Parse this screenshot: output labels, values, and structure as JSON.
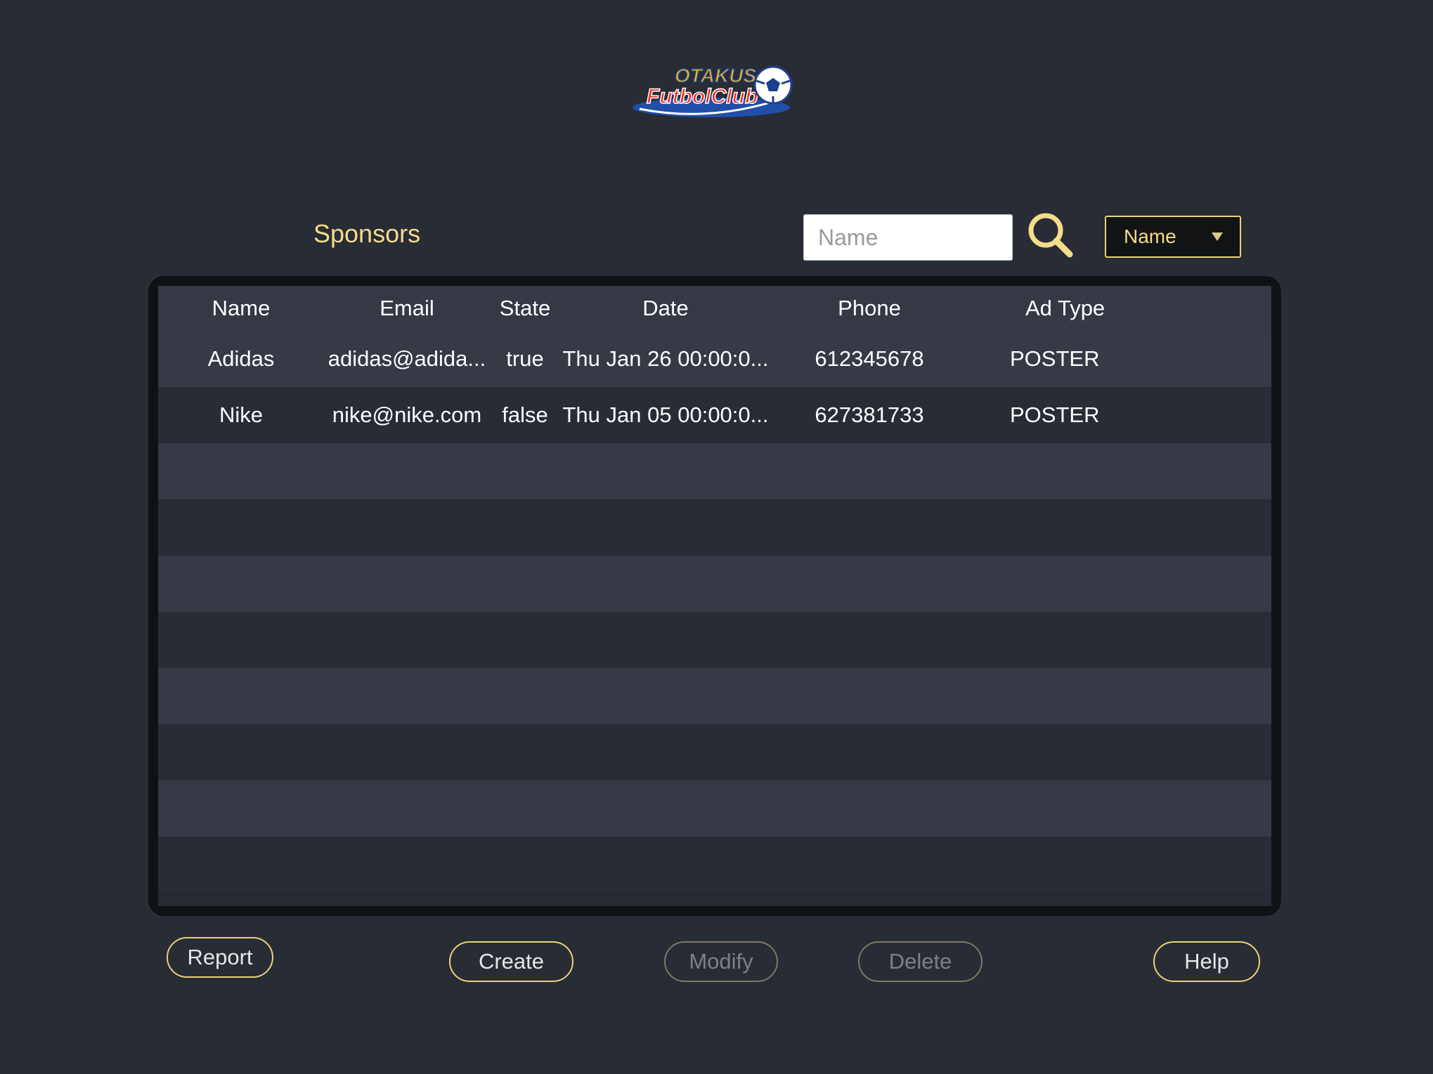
{
  "brand": {
    "logo_line1": "OTAKUS",
    "logo_line2": "FutbolClub"
  },
  "page": {
    "title": "Sponsors"
  },
  "search": {
    "placeholder": "Name",
    "value": "",
    "icon": "search-icon"
  },
  "filter": {
    "selected": "Name"
  },
  "table": {
    "columns": [
      "Name",
      "Email",
      "State",
      "Date",
      "Phone",
      "Ad Type"
    ],
    "rows": [
      [
        "Adidas",
        "adidas@adida...",
        "true",
        "Thu Jan 26 00:00:0...",
        "612345678",
        "POSTER"
      ],
      [
        "Nike",
        "nike@nike.com",
        "false",
        "Thu Jan 05 00:00:0...",
        "627381733",
        "POSTER"
      ]
    ]
  },
  "buttons": {
    "report": "Report",
    "create": "Create",
    "modify": "Modify",
    "delete": "Delete",
    "help": "Help"
  },
  "colors": {
    "background": "#282c35",
    "accent": "#f3dc8a",
    "button_border": "#e9d27c"
  }
}
